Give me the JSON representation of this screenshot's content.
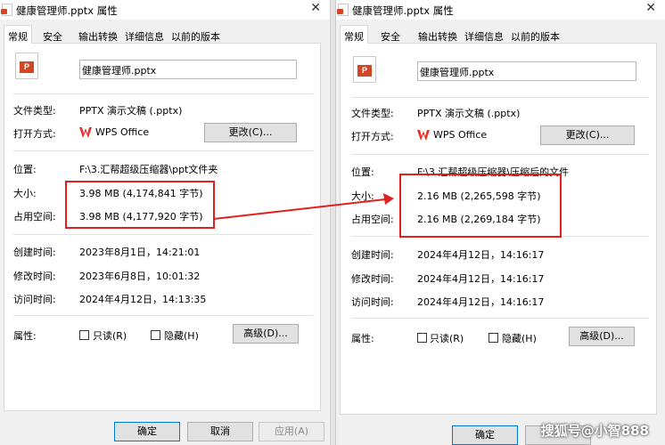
{
  "left": {
    "title": "健康管理师.pptx 属性",
    "tabs": [
      "常规",
      "安全",
      "输出转换",
      "详细信息",
      "以前的版本"
    ],
    "file_name": "健康管理师.pptx",
    "rows": {
      "type_label": "文件类型:",
      "type_value": "PPTX 演示文稿 (.pptx)",
      "open_label": "打开方式:",
      "open_value": "WPS Office",
      "change_button": "更改(C)...",
      "location_label": "位置:",
      "location_value": "F:\\3.汇帮超级压缩器\\ppt文件夹",
      "size_label": "大小:",
      "size_value": "3.98 MB (4,174,841 字节)",
      "disk_label": "占用空间:",
      "disk_value": "3.98 MB (4,177,920 字节)",
      "created_label": "创建时间:",
      "created_value": "2023年8月1日，14:21:01",
      "modified_label": "修改时间:",
      "modified_value": "2023年6月8日，10:01:32",
      "accessed_label": "访问时间:",
      "accessed_value": "2024年4月12日，14:13:35",
      "attr_label": "属性:",
      "readonly_label": "只读(R)",
      "hidden_label": "隐藏(H)",
      "advanced_button": "高级(D)..."
    },
    "buttons": {
      "ok": "确定",
      "cancel": "取消",
      "apply": "应用(A)"
    }
  },
  "right": {
    "title": "健康管理师.pptx 属性",
    "tabs": [
      "常规",
      "安全",
      "输出转换",
      "详细信息",
      "以前的版本"
    ],
    "file_name": "健康管理师.pptx",
    "rows": {
      "type_label": "文件类型:",
      "type_value": "PPTX 演示文稿 (.pptx)",
      "open_label": "打开方式:",
      "open_value": "WPS Office",
      "change_button": "更改(C)...",
      "location_label": "位置:",
      "location_value": "F:\\3.汇帮超级压缩器\\压缩后的文件",
      "size_label": "大小:",
      "size_value": "2.16 MB (2,265,598 字节)",
      "disk_label": "占用空间:",
      "disk_value": "2.16 MB (2,269,184 字节)",
      "created_label": "创建时间:",
      "created_value": "2024年4月12日，14:16:17",
      "modified_label": "修改时间:",
      "modified_value": "2024年4月12日，14:16:17",
      "accessed_label": "访问时间:",
      "accessed_value": "2024年4月12日，14:16:17",
      "attr_label": "属性:",
      "readonly_label": "只读(R)",
      "hidden_label": "隐藏(H)",
      "advanced_button": "高级(D)..."
    },
    "buttons": {
      "ok": "确定"
    }
  },
  "file_badge": "P",
  "close_glyph": "✕",
  "watermark": "搜狐号@小智888",
  "colors": {
    "highlight": "#e02020",
    "pptx": "#d24625",
    "wps": "#e8342a",
    "accent_border": "#0078d7"
  }
}
